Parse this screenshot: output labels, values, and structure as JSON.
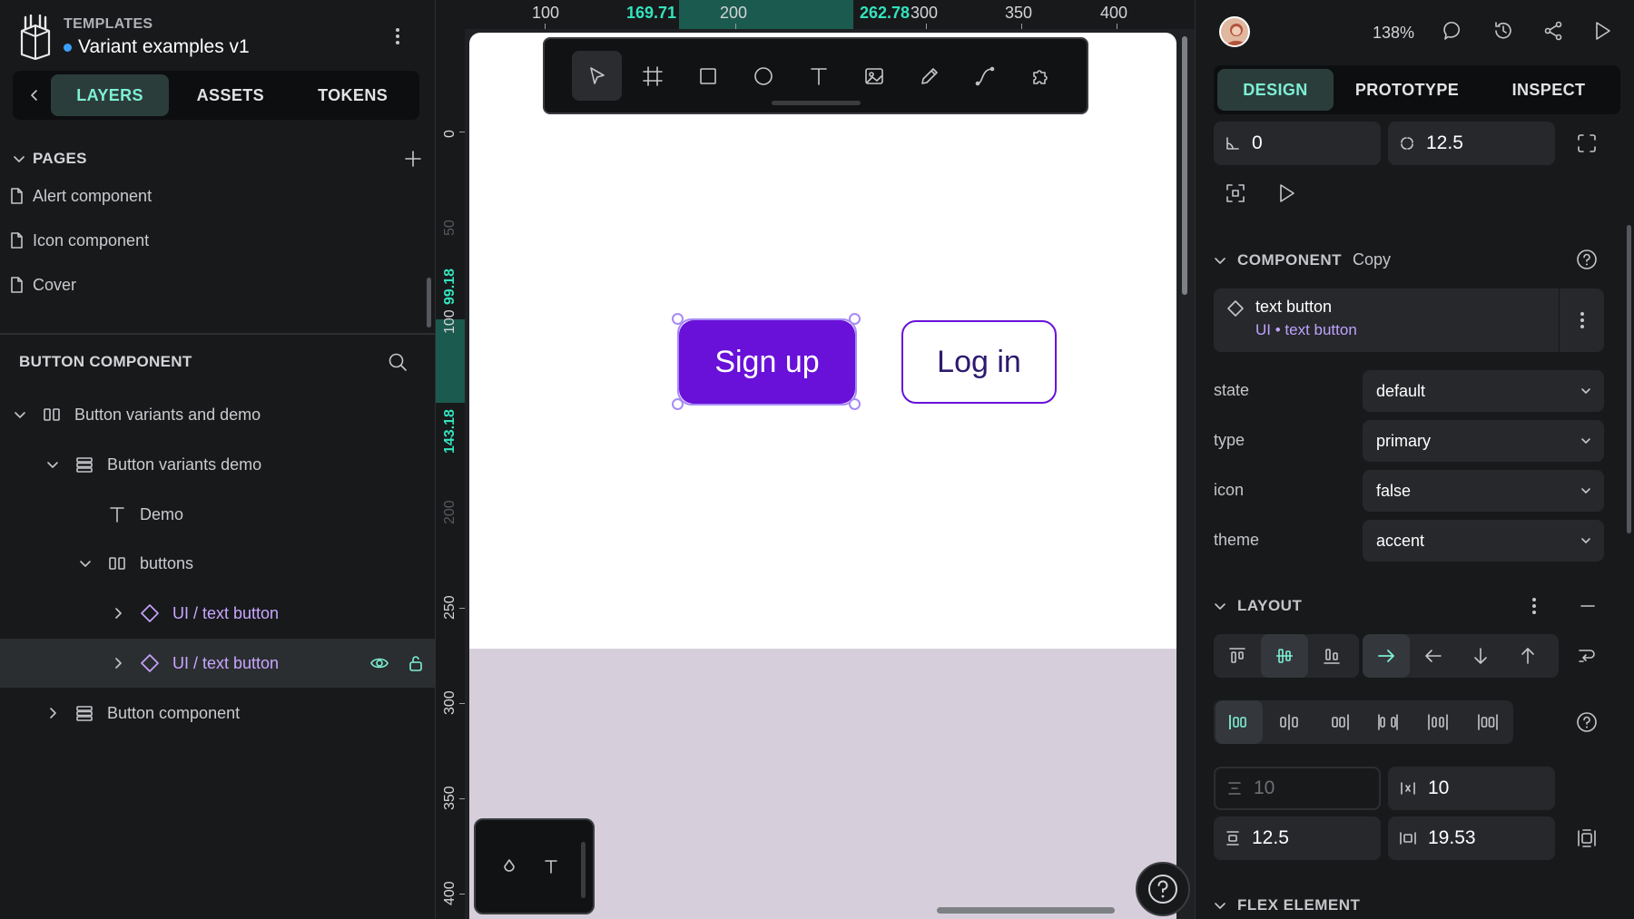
{
  "project": {
    "team": "TEMPLATES",
    "name": "Variant examples v1"
  },
  "left_tabs": [
    "LAYERS",
    "ASSETS",
    "TOKENS"
  ],
  "pages": {
    "title": "PAGES",
    "items": [
      "Alert component",
      "Icon component",
      "Cover"
    ]
  },
  "layers_section": {
    "title": "BUTTON COMPONENT",
    "items": [
      "Button variants and demo",
      "Button variants demo",
      "Demo",
      "buttons",
      "UI / text button",
      "UI / text button",
      "Button component"
    ]
  },
  "ruler": {
    "top": [
      "100",
      "169.71",
      "200",
      "262.78",
      "300",
      "350",
      "400"
    ],
    "left": [
      "0",
      "50",
      "99.18",
      "100",
      "143.18",
      "200",
      "250",
      "300",
      "350",
      "400"
    ]
  },
  "canvas": {
    "signup_label": "Sign up",
    "login_label": "Log in"
  },
  "right": {
    "zoom": "138%",
    "tabs": [
      "DESIGN",
      "PROTOTYPE",
      "INSPECT"
    ],
    "rotation": "0",
    "radius": "12.5",
    "component": {
      "title": "COMPONENT",
      "copy_label": "Copy",
      "name": "text button",
      "path": "UI • text button"
    },
    "props": [
      {
        "label": "state",
        "value": "default"
      },
      {
        "label": "type",
        "value": "primary"
      },
      {
        "label": "icon",
        "value": "false"
      },
      {
        "label": "theme",
        "value": "accent"
      }
    ],
    "layout_title": "LAYOUT",
    "row_gap": "10",
    "column_gap": "10",
    "padding_vertical": "12.5",
    "padding_horizontal": "19.53",
    "flex_title": "FLEX ELEMENT"
  },
  "colors": {
    "accent": "#7ef0d4",
    "ruler_highlight": "#33e3bd",
    "primary_button": "#6911d9",
    "component_text": "#c8a6ff"
  }
}
